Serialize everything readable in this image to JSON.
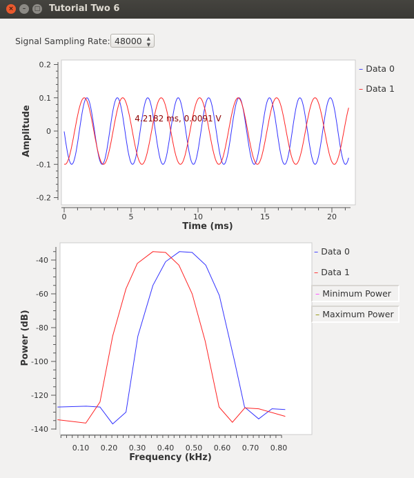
{
  "window": {
    "title": "Tutorial Two 6",
    "close": "×",
    "minimize": "–",
    "maximize": "□"
  },
  "controls": {
    "rate_label": "Signal Sampling Rate:",
    "rate_value": "48000"
  },
  "colors": {
    "data0": "#3030ff",
    "data1": "#ff2020",
    "min_power": "#ff40ff",
    "max_power": "#909000"
  },
  "chart_data": [
    {
      "type": "line",
      "xlabel": "Time (ms)",
      "ylabel": "Amplitude",
      "xlim": [
        0,
        21.3
      ],
      "ylim": [
        -0.2,
        0.2
      ],
      "xticks": [
        "0",
        "5",
        "10",
        "15",
        "20"
      ],
      "yticks": [
        "0.2",
        "0.1",
        "0",
        "-0.1",
        "-0.2"
      ],
      "annotation": "4.2182 ms, 0.0091 V",
      "legend_placement": "right",
      "series": [
        {
          "name": "Data 0",
          "waveform": "sinusoid",
          "amplitude": 0.1,
          "frequency_khz": 0.44,
          "peak_time_ms": 1.7
        },
        {
          "name": "Data 1",
          "waveform": "sinusoid",
          "amplitude": 0.1,
          "frequency_khz": 0.348,
          "peak_time_ms": 1.5
        }
      ]
    },
    {
      "type": "line",
      "xlabel": "Frequency (kHz)",
      "ylabel": "Power (dB)",
      "xlim": [
        0.02,
        0.83
      ],
      "ylim": [
        -143,
        -31
      ],
      "xticks": [
        "0.10",
        "0.20",
        "0.30",
        "0.40",
        "0.50",
        "0.60",
        "0.70",
        "0.80"
      ],
      "yticks": [
        "-40",
        "-60",
        "-80",
        "-100",
        "-120",
        "-140"
      ],
      "legend_placement": "right",
      "legend_extra": [
        "Minimum Power",
        "Maximum Power"
      ],
      "series": [
        {
          "name": "Data 0",
          "x": [
            0.018,
            0.12,
            0.168,
            0.213,
            0.26,
            0.302,
            0.355,
            0.4,
            0.449,
            0.494,
            0.542,
            0.59,
            0.644,
            0.679,
            0.729,
            0.776,
            0.823
          ],
          "y": [
            -127,
            -126.5,
            -127,
            -137,
            -130,
            -85,
            -55,
            -41,
            -35,
            -35.5,
            -43,
            -61,
            -100,
            -127,
            -134,
            -128,
            -128.5
          ]
        },
        {
          "name": "Data 1",
          "x": [
            0.018,
            0.118,
            0.168,
            0.213,
            0.26,
            0.3,
            0.355,
            0.4,
            0.447,
            0.494,
            0.54,
            0.589,
            0.636,
            0.68,
            0.729,
            0.823
          ],
          "y": [
            -134.5,
            -136.5,
            -124,
            -85,
            -57,
            -42,
            -35,
            -35.5,
            -43,
            -60,
            -88,
            -127,
            -136,
            -127.5,
            -128,
            -132.5
          ]
        }
      ]
    }
  ]
}
